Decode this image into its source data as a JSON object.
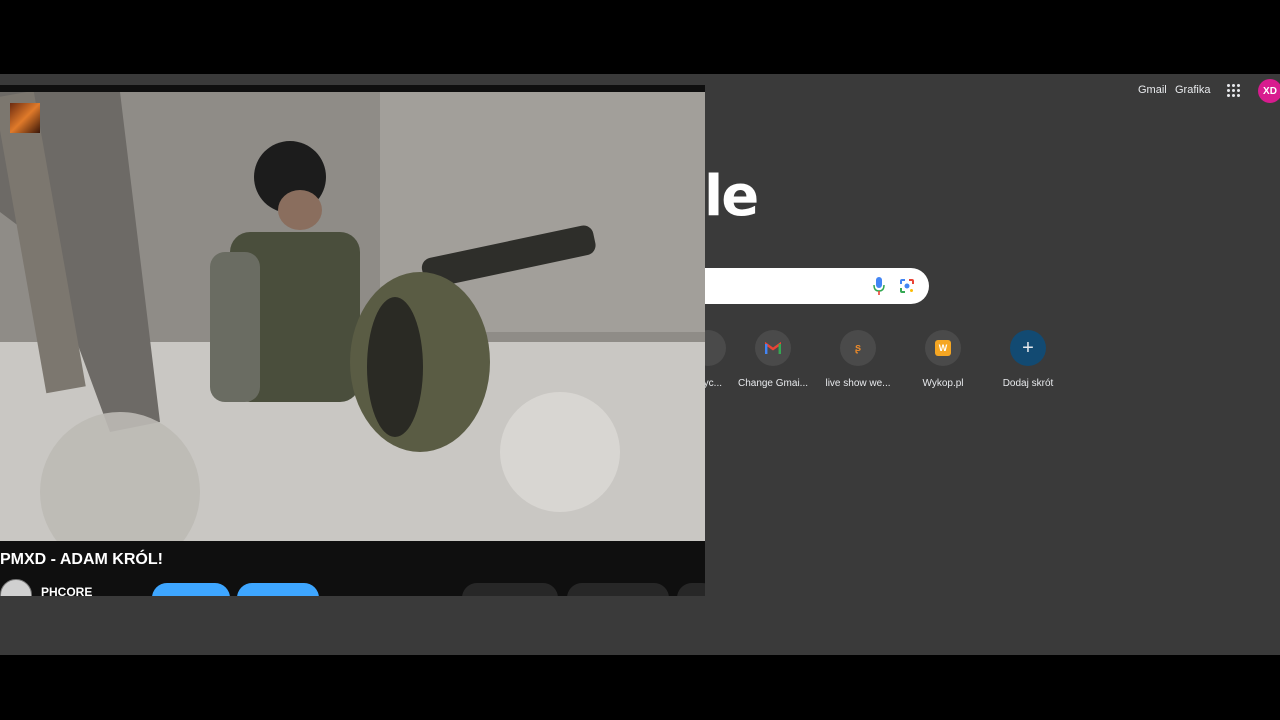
{
  "header": {
    "gmail_label": "Gmail",
    "images_label": "Grafika",
    "avatar_initials": "XD"
  },
  "logo": {
    "visible_fragment": "le"
  },
  "shortcuts": [
    {
      "label": "...ayc...",
      "icon": "partial-shortcut-icon"
    },
    {
      "label": "Change Gmai...",
      "icon": "gmail-icon"
    },
    {
      "label": "live show we...",
      "icon": "orange-s-icon"
    },
    {
      "label": "Wykop.pl",
      "icon": "wykop-icon"
    },
    {
      "label": "Dodaj skrót",
      "icon": "plus-icon"
    }
  ],
  "video": {
    "title": "PMXD - ADAM KRÓL!",
    "channel_name": "PHCORE"
  },
  "colors": {
    "page_bg": "#3a3a3a",
    "avatar": "#d81b8f",
    "accent_blue": "#3ea6ff",
    "add_shortcut": "#124a72"
  }
}
